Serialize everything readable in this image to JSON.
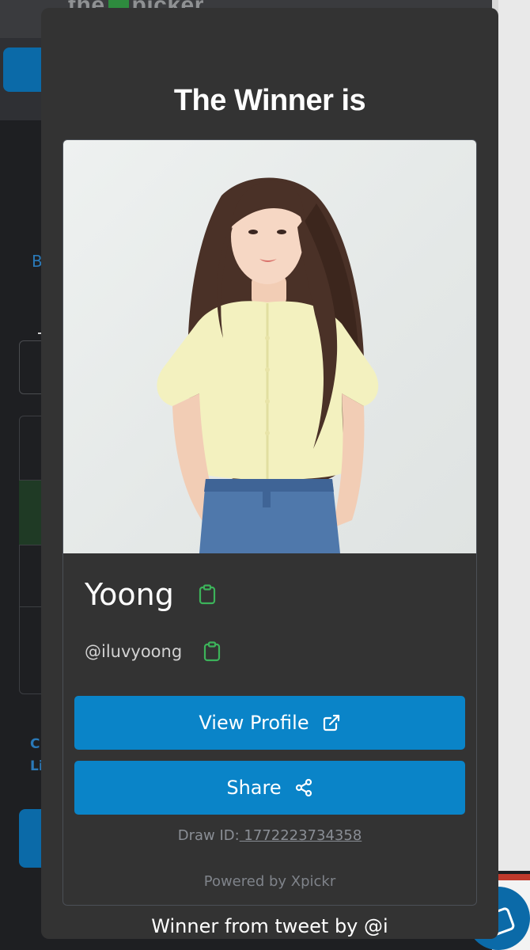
{
  "background": {
    "logo_text_left": "the",
    "logo_text_right": "picker",
    "link_fragment": "B",
    "side_text_line1": "C",
    "side_text_line2": "Li"
  },
  "modal": {
    "title": "The Winner is",
    "winner": {
      "name": "Yoong",
      "handle": "@iluvyoong",
      "photo_alt": "Winner profile photo"
    },
    "buttons": {
      "view_profile": "View Profile",
      "share": "Share"
    },
    "draw_id_label": "Draw ID:",
    "draw_id_value": " 1772223734358",
    "powered_by": "Powered by Xpickr",
    "tweet_caption": "Winner from tweet by @i"
  },
  "colors": {
    "accent_blue": "#0a84c8",
    "copy_icon_green": "#3cb35a",
    "modal_bg": "#333333"
  },
  "icons": {
    "copy": "clipboard-icon",
    "external": "external-link-icon",
    "share": "share-nodes-icon"
  }
}
